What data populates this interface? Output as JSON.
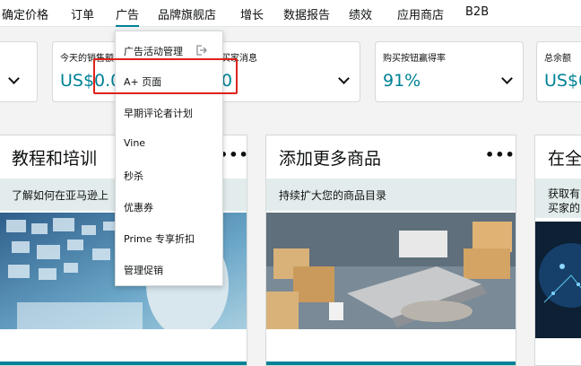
{
  "nav": {
    "items": [
      {
        "label": "确定价格"
      },
      {
        "label": "订单"
      },
      {
        "label": "广告"
      },
      {
        "label": "品牌旗舰店"
      },
      {
        "label": "增长"
      },
      {
        "label": "数据报告"
      },
      {
        "label": "绩效"
      },
      {
        "label": "应用商店"
      },
      {
        "label": "B2B"
      }
    ]
  },
  "metrics": [
    {
      "label": "今天的销售额",
      "value": "US$0.00"
    },
    {
      "label": "买家消息",
      "value": "0"
    },
    {
      "label": "购买按钮赢得率",
      "value": "91%"
    },
    {
      "label": "总余额",
      "value": "US$0"
    }
  ],
  "cards": [
    {
      "title": "教程和培训",
      "band": "了解如何在亚马逊上"
    },
    {
      "title": "添加更多商品",
      "band": "持续扩大您的商品目录"
    },
    {
      "title": "在全",
      "band": "获取有",
      "band2": "买家的"
    }
  ],
  "dropdown": {
    "items": [
      {
        "label": "广告活动管理"
      },
      {
        "label": "A+ 页面"
      },
      {
        "label": "早期评论者计划"
      },
      {
        "label": "Vine"
      },
      {
        "label": "秒杀"
      },
      {
        "label": "优惠券"
      },
      {
        "label": "Prime 专享折扣"
      },
      {
        "label": "管理促销"
      }
    ]
  },
  "colors": {
    "accent": "#008296",
    "highlight": "#e0211b",
    "band": "#e3ecec"
  }
}
